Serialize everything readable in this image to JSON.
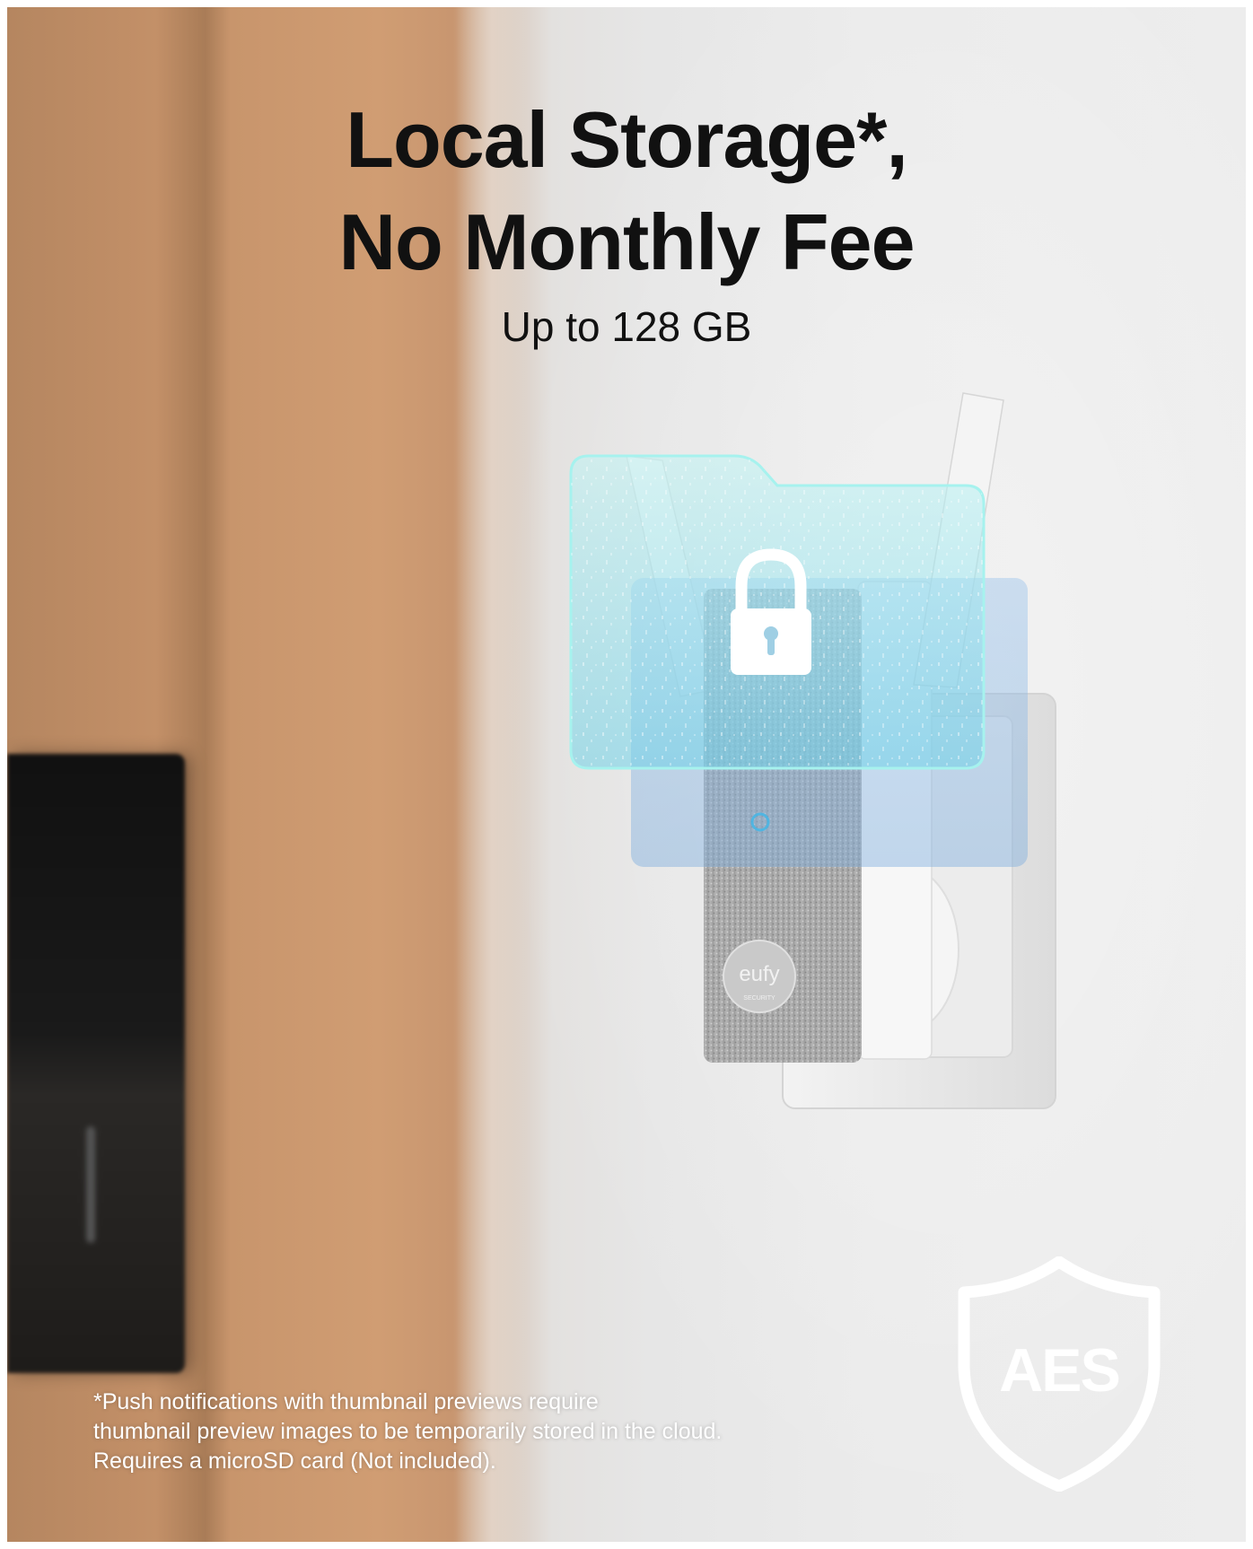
{
  "headline": {
    "line_1": "Local Storage*,",
    "line_2": "No Monthly Fee",
    "subtitle": "Up to 128 GB"
  },
  "device": {
    "brand_mark": "eufy",
    "brand_sub": "SECURITY"
  },
  "footnote": {
    "line_1": "*Push notifications with thumbnail previews require",
    "line_2": "thumbnail preview images to be temporarily stored in the cloud.",
    "line_3": "Requires a microSD card (Not included)."
  },
  "badge": {
    "label": "AES",
    "icon": "shield-icon"
  },
  "overlay": {
    "icon": "lock-icon",
    "folder_icon": "folder-icon"
  },
  "colors": {
    "headline": "#111111",
    "footnote": "#ffffff",
    "overlay_cyan": "#7fe6e6",
    "badge": "#ffffff"
  }
}
